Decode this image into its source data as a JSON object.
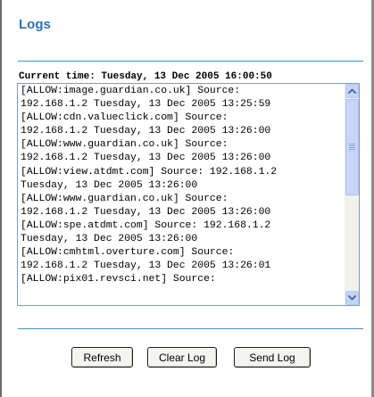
{
  "page": {
    "title": "Logs",
    "current_time_label": "Current time: Tuesday, 13 Dec 2005 16:00:50"
  },
  "log": {
    "lines": [
      "[ALLOW:image.guardian.co.uk] Source:",
      "192.168.1.2 Tuesday, 13 Dec 2005 13:25:59",
      "[ALLOW:cdn.valueclick.com] Source:",
      "192.168.1.2 Tuesday, 13 Dec 2005 13:26:00",
      "[ALLOW:www.guardian.co.uk] Source:",
      "192.168.1.2 Tuesday, 13 Dec 2005 13:26:00",
      "[ALLOW:view.atdmt.com] Source: 192.168.1.2",
      "Tuesday, 13 Dec 2005 13:26:00",
      "[ALLOW:www.guardian.co.uk] Source:",
      "192.168.1.2 Tuesday, 13 Dec 2005 13:26:00",
      "[ALLOW:spe.atdmt.com] Source: 192.168.1.2",
      "Tuesday, 13 Dec 2005 13:26:00",
      "[ALLOW:cmhtml.overture.com] Source:",
      "192.168.1.2 Tuesday, 13 Dec 2005 13:26:01",
      "[ALLOW:pix01.revsci.net] Source:"
    ]
  },
  "buttons": {
    "refresh": "Refresh",
    "clear_log": "Clear Log",
    "send_log": "Send Log"
  },
  "colors": {
    "title": "#2a71b8",
    "rule": "#3b95cf",
    "scrollbar_button": "#c3d3fd"
  },
  "icons": {
    "scroll_up": "chevron-up-icon",
    "scroll_down": "chevron-down-icon"
  }
}
